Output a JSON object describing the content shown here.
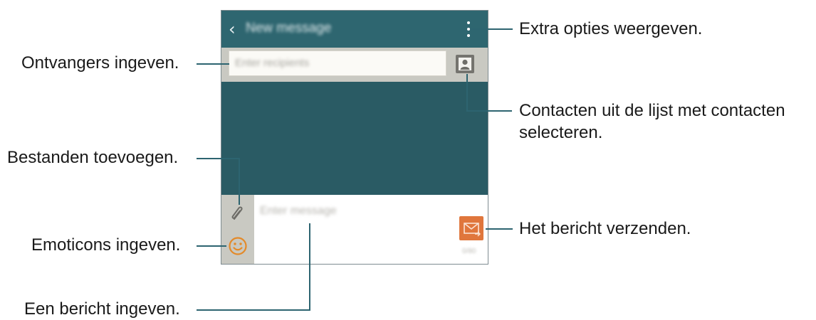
{
  "screen": {
    "title": "New message",
    "recipient_placeholder": "Enter recipients",
    "message_placeholder": "Enter message",
    "counter": "0/80"
  },
  "callouts": {
    "more_options": "Extra opties weergeven.",
    "recipients": "Ontvangers ingeven.",
    "contacts_line1": "Contacten uit de lijst met contacten",
    "contacts_line2": "selecteren.",
    "attach": "Bestanden toevoegen.",
    "emoticons": "Emoticons ingeven.",
    "send": "Het bericht verzenden.",
    "message": "Een bericht ingeven."
  },
  "icons": {
    "back": "back-icon",
    "more": "more-vertical-icon",
    "contact": "contact-icon",
    "attach": "paperclip-icon",
    "emoticon": "smiley-icon",
    "send": "send-icon"
  },
  "colors": {
    "appbar": "#2e6670",
    "body": "#2a5b64",
    "panel": "#c9c9c2",
    "send": "#e0763c",
    "emoticon": "#e38a2a",
    "leader": "#2d6470"
  }
}
